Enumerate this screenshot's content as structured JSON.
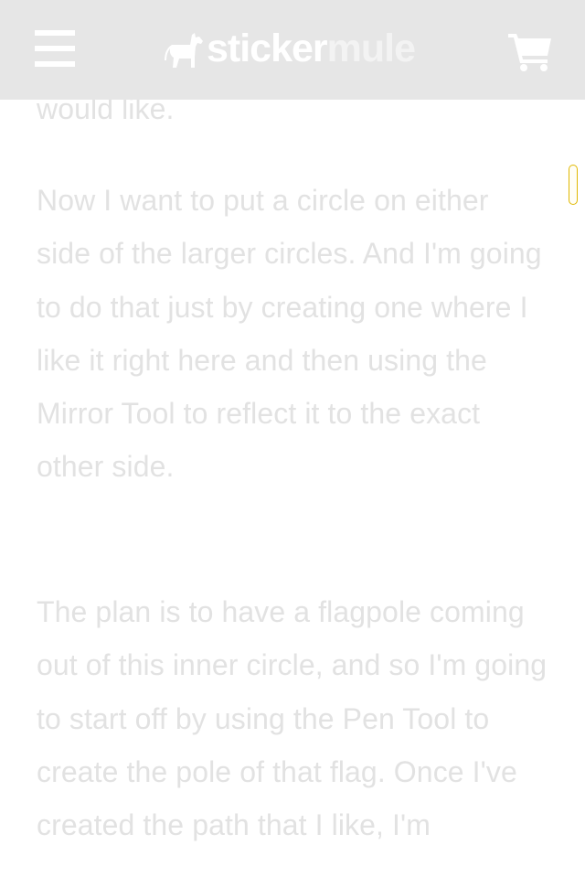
{
  "header": {
    "menu_icon": "hamburger-menu-icon",
    "logo": {
      "part1": "sticker",
      "part2": "mule",
      "icon": "mule-icon"
    },
    "cart_icon": "shopping-cart-icon",
    "background": "#e6e6e6"
  },
  "article": {
    "paragraphs": [
      {
        "text": "would like."
      },
      {
        "text": "Now I want to put a circle on either side of the larger circles. And I'm going to do that just by creating one where I like it right here and then using the Mirror Tool to reflect it to the exact other side."
      },
      {
        "text": "The plan is to have a flagpole coming out of this inner circle, and so I'm going to start off by using the Pen Tool to create the pole of that flag. Once I've created the path that I like, I'm"
      }
    ],
    "text_color": "#e2e2e2"
  },
  "scrollbar": {
    "accent_color": "#e0b800"
  }
}
